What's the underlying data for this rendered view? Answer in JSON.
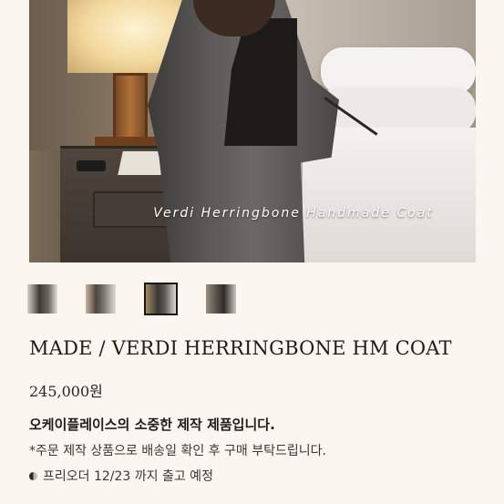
{
  "product_image": {
    "caption": "Verdi Herringbone Handmade Coat"
  },
  "thumbnails": {
    "active_index": 2,
    "count": 4
  },
  "product": {
    "title": "MADE / VERDI HERRINGBONE HM COAT",
    "price": "245,000원"
  },
  "notices": {
    "line1": "오케이플레이스의 소중한 제작 제품입니다.",
    "line2": "*주문 제작 상품으로 배송일 확인 후 구매 부탁드립니다.",
    "line3": "프리오더 12/23 까지 출고 예정"
  }
}
